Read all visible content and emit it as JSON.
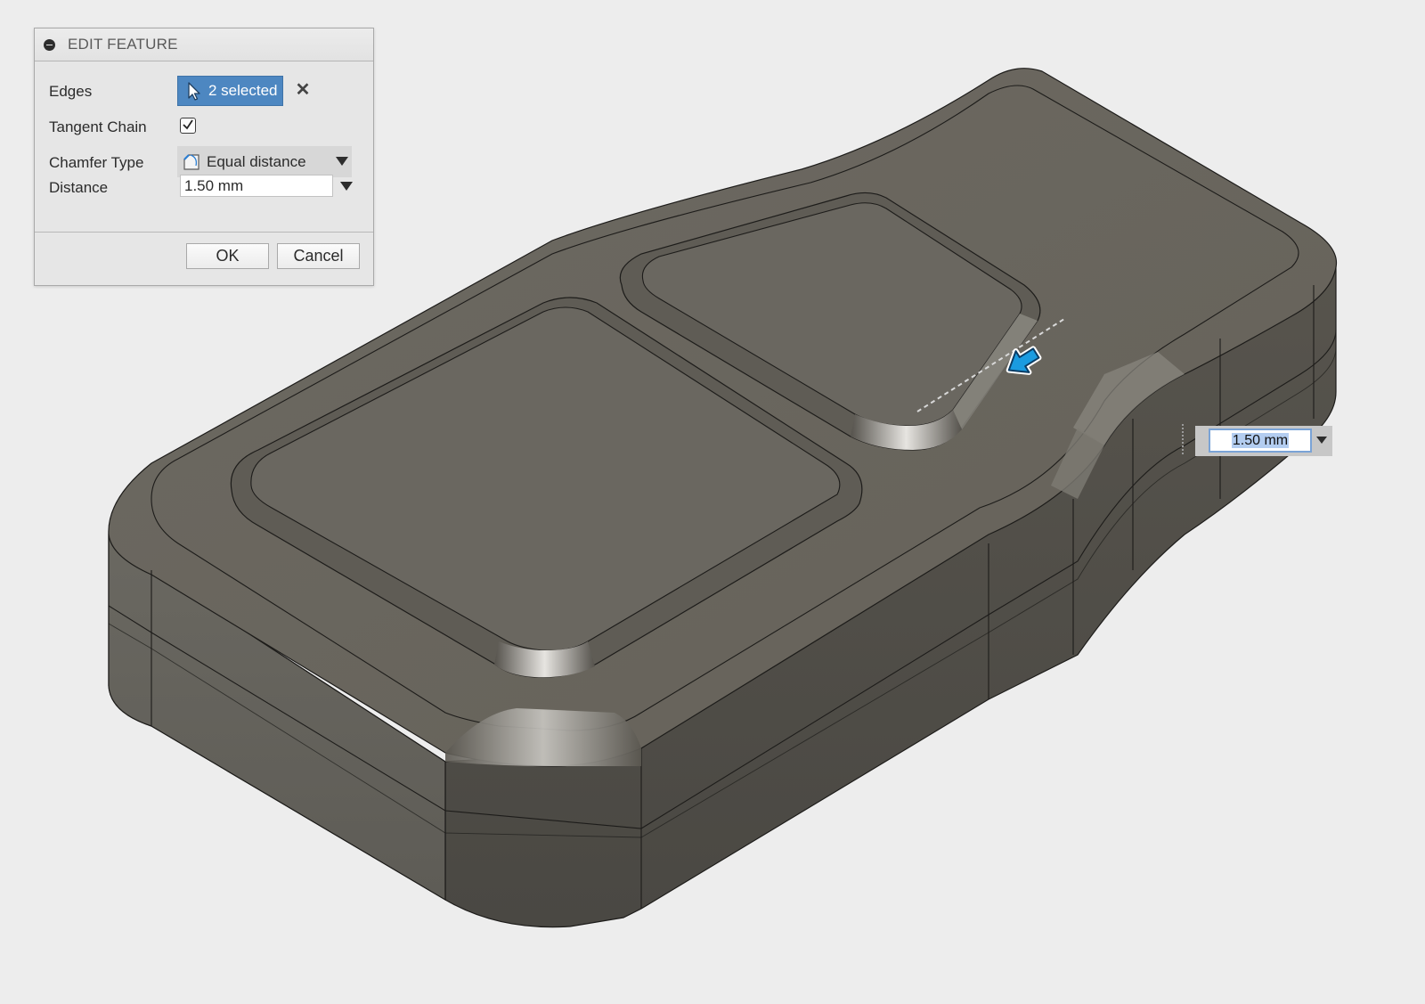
{
  "dialog": {
    "title": "EDIT FEATURE",
    "edges_label": "Edges",
    "edges_value": "2 selected",
    "tangent_chain_label": "Tangent Chain",
    "tangent_chain_checked": true,
    "chamfer_type_label": "Chamfer Type",
    "chamfer_type_value": "Equal distance",
    "distance_label": "Distance",
    "distance_value": "1.50 mm",
    "ok_label": "OK",
    "cancel_label": "Cancel"
  },
  "canvas_input": {
    "value": "1.50 mm"
  },
  "icons": {
    "collapse": "collapse-icon",
    "select_cursor": "cursor-icon",
    "clear": "close-icon",
    "chamfer_type": "chamfer-type-icon",
    "dropdown": "chevron-down-icon",
    "manipulator": "drag-arrow-icon"
  },
  "colors": {
    "background": "#ededed",
    "model_top": "#6b6760",
    "model_side": "#5a5750",
    "selection_blue": "#4d87c1",
    "manipulator_blue": "#1a9be0"
  }
}
